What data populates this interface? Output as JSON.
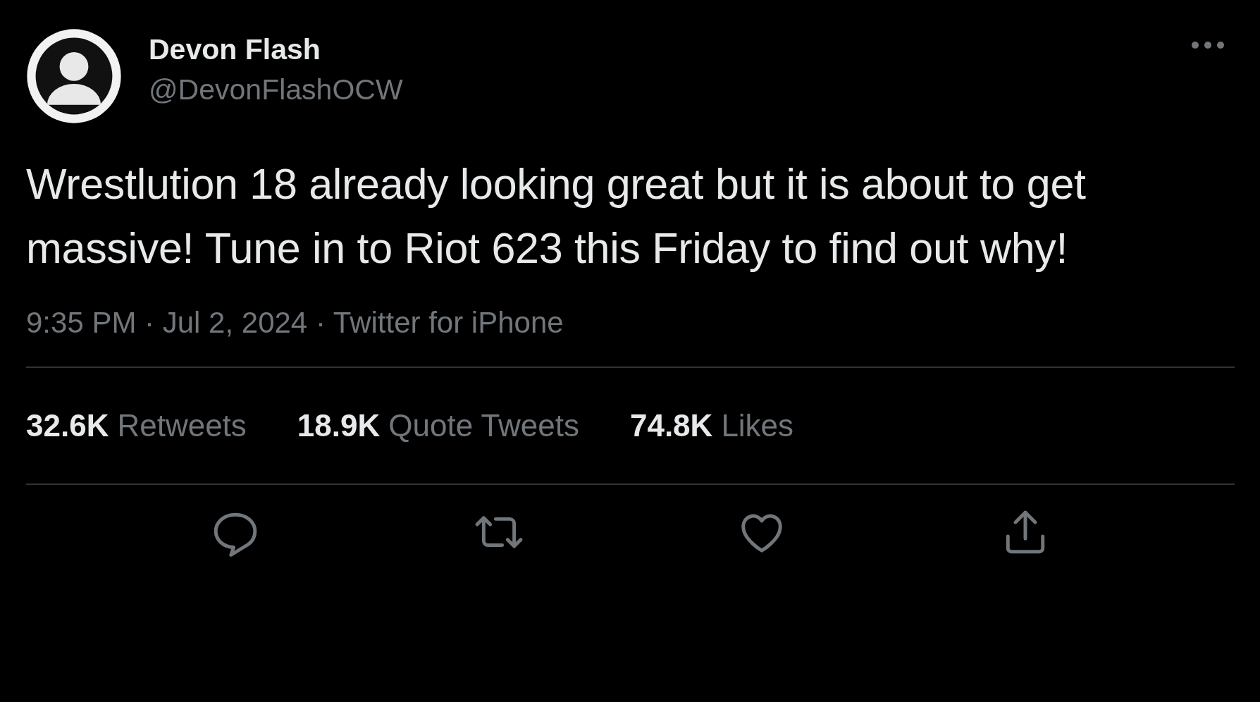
{
  "author": {
    "name": "Devon Flash",
    "handle": "@DevonFlashOCW"
  },
  "text": "Wrestlution 18 already looking great but it is about to get massive! Tune in to Riot 623 this Friday to find out why!",
  "meta": "9:35 PM · Jul 2, 2024 · Twitter for iPhone",
  "stats": [
    {
      "count": "32.6K",
      "label": "Retweets"
    },
    {
      "count": "18.9K",
      "label": "Quote Tweets"
    },
    {
      "count": "74.8K",
      "label": "Likes"
    }
  ],
  "actions": [
    {
      "kind": "reply"
    },
    {
      "kind": "retweet"
    },
    {
      "kind": "like"
    },
    {
      "kind": "share"
    }
  ]
}
